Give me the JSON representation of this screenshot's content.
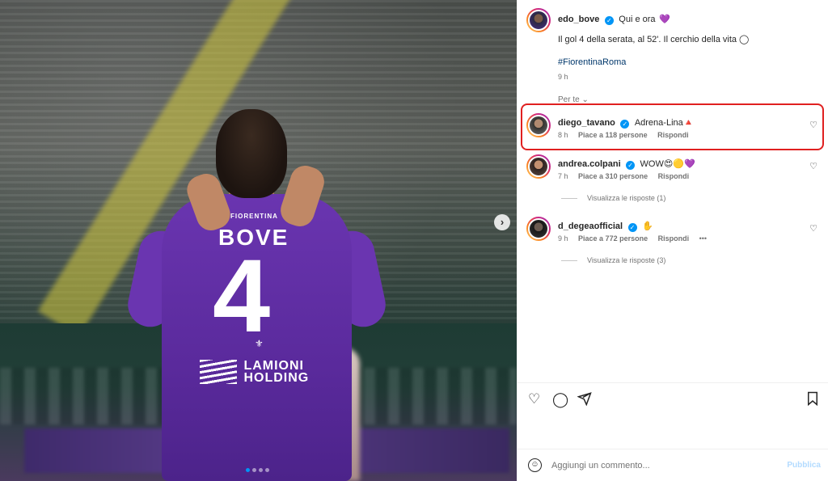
{
  "media": {
    "jersey": {
      "club": "FIORENTINA",
      "name": "BOVE",
      "number": "4",
      "sponsor_line1": "LAMIONI",
      "sponsor_line2": "HOLDING"
    },
    "next_icon": "chevron-right-icon",
    "carousel": {
      "count": 4,
      "active_index": 0
    }
  },
  "post": {
    "author": "edo_bove",
    "caption_head": "Qui e ora",
    "caption_emoji": "💜",
    "caption_body": "Il gol 4 della serata, al 52'. Il cerchio della vita ◯",
    "hashtag": "#FiorentinaRoma",
    "time": "9 h",
    "translation_label": "Per te",
    "verified_icon": "verified-badge-icon"
  },
  "comments": [
    {
      "user": "diego_tavano",
      "text": "Adrena-Lina",
      "suffix": "🔺",
      "time": "8 h",
      "likes": "Piace a 118 persone",
      "reply": "Rispondi",
      "highlighted": true
    },
    {
      "user": "andrea.colpani",
      "text": "WOW",
      "suffix": "😍🟡💜",
      "time": "7 h",
      "likes": "Piace a 310 persone",
      "reply": "Rispondi",
      "replies": "Visualizza le risposte (1)"
    },
    {
      "user": "d_degeaofficial",
      "text": "",
      "suffix": "✋",
      "time": "9 h",
      "likes": "Piace a 772 persone",
      "reply": "Rispondi",
      "more": "•••",
      "replies": "Visualizza le risposte (3)"
    }
  ],
  "actions": {
    "like_icon": "♡",
    "comment_icon": "◯",
    "share_icon": "➢",
    "save_icon": "🔖"
  },
  "add_comment": {
    "placeholder": "Aggiungi un commento...",
    "publish": "Pubblica",
    "emoji_icon": "☺"
  },
  "colors": {
    "accent": "#0095f6",
    "highlight_border": "#e02020",
    "jersey": "#6a35b0"
  }
}
